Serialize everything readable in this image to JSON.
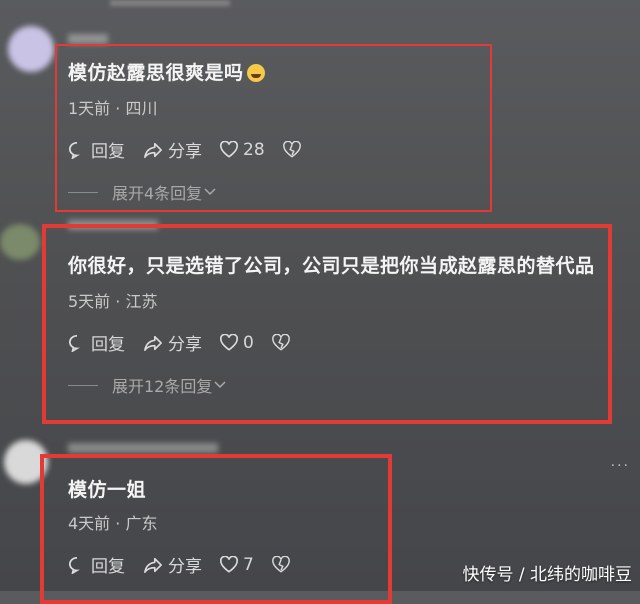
{
  "comments": [
    {
      "text": "模仿赵露思很爽是吗",
      "emoji": "rolling-laughing-face-emoji",
      "meta": "1天前 · 四川",
      "reply": "回复",
      "share": "分享",
      "likes": "28",
      "expand": "展开4条回复"
    },
    {
      "text": "你很好，只是选错了公司，公司只是把你当成赵露思的替代品",
      "meta": "5天前 · 江苏",
      "reply": "回复",
      "share": "分享",
      "likes": "0",
      "expand": "展开12条回复"
    },
    {
      "text": "模仿一姐",
      "meta": "4天前 · 广东",
      "reply": "回复",
      "share": "分享",
      "likes": "7"
    }
  ],
  "watermark": "快传号 / 北纬的咖啡豆",
  "colors": {
    "highlight": "#e23a35",
    "background": "#4f5052"
  }
}
